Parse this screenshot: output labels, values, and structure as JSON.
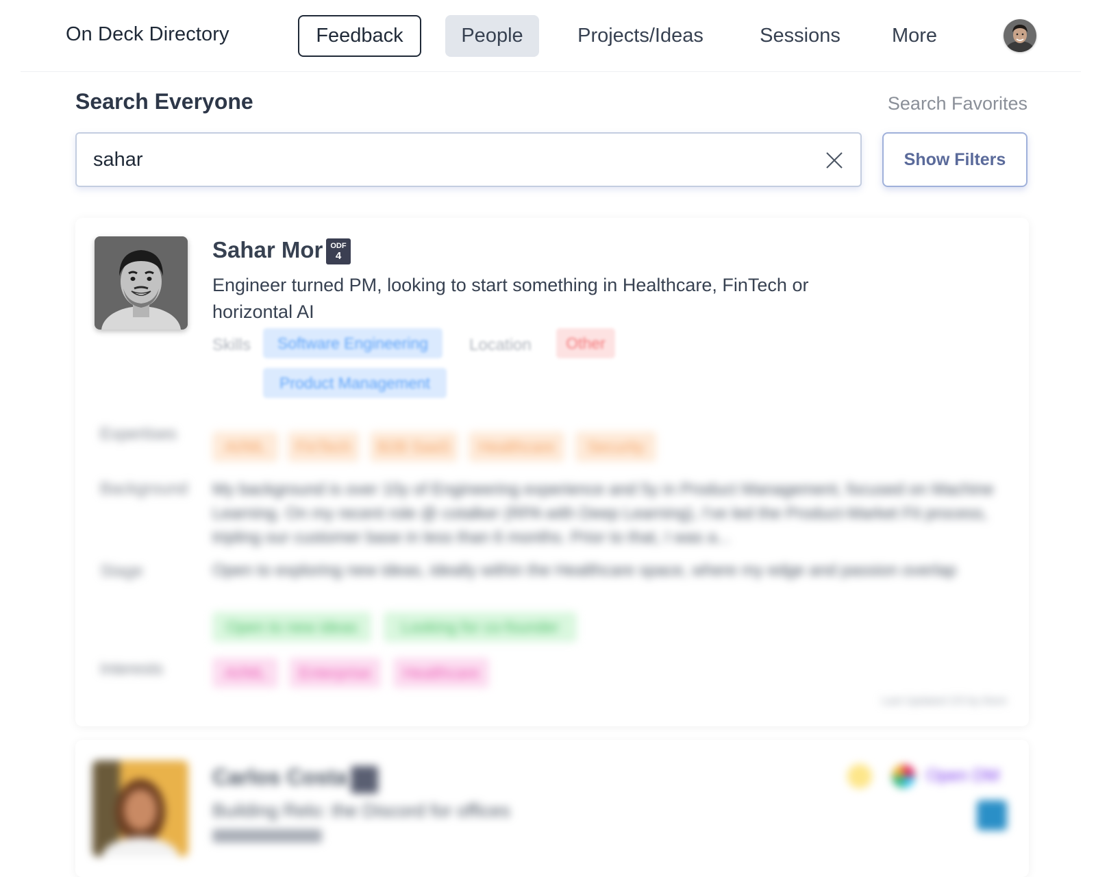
{
  "nav": {
    "brand": "On Deck Directory",
    "items": [
      {
        "label": "Feedback"
      },
      {
        "label": "People"
      },
      {
        "label": "Projects/Ideas"
      },
      {
        "label": "Sessions"
      },
      {
        "label": "More"
      }
    ],
    "avatar_icon": "user-avatar"
  },
  "search": {
    "title": "Search Everyone",
    "favorites_link": "Search Favorites",
    "value": "sahar",
    "clear_icon": "close-icon",
    "filters_button": "Show Filters"
  },
  "result": {
    "name": "Sahar Mor",
    "badge": {
      "line1": "ODF",
      "line2": "4"
    },
    "tagline": "Engineer turned PM, looking to start something in Healthcare, FinTech or horizontal AI",
    "skills_label": "Skills",
    "skills": [
      "Software Engineering",
      "Product Management"
    ],
    "location_label": "Location",
    "location": "Other",
    "expertises_label": "Expertises",
    "expertises": [
      "AI/ML",
      "FinTech",
      "B2B SaaS",
      "Healthcare",
      "Security"
    ],
    "background_label": "Background",
    "background": "My background is over 10y of Engineering experience and 5y in Product Management, focused on Machine Learning. On my recent role @ cotalker (RPA with Deep Learning), I've led the Product-Market Fit process, tripling our customer base in less than 6 months. Prior to that, I was a...",
    "stage_label": "Stage",
    "stage": "Open to exploring new ideas, ideally within the Healthcare space, where my edge and passion overlap",
    "stage_tags": [
      "Open to new ideas",
      "Looking for co-founder"
    ],
    "interests_label": "Interests",
    "interests": [
      "AI/ML",
      "Enterprise",
      "Healthcare"
    ],
    "updated": "Last Updated 2/3 by them"
  },
  "result2": {
    "name": "Carlos Costa",
    "tagline": "Building Relo: the Discord for offices",
    "open_dm": "Open DM"
  },
  "colors": {
    "skill_chip": "#dbeafe",
    "location_chip": "#fde2e2",
    "expertise_chip": "#feead8",
    "stage_chip": "#d9f7de",
    "interest_chip": "#fcdcf0",
    "badge_bg": "#3b3f52"
  }
}
